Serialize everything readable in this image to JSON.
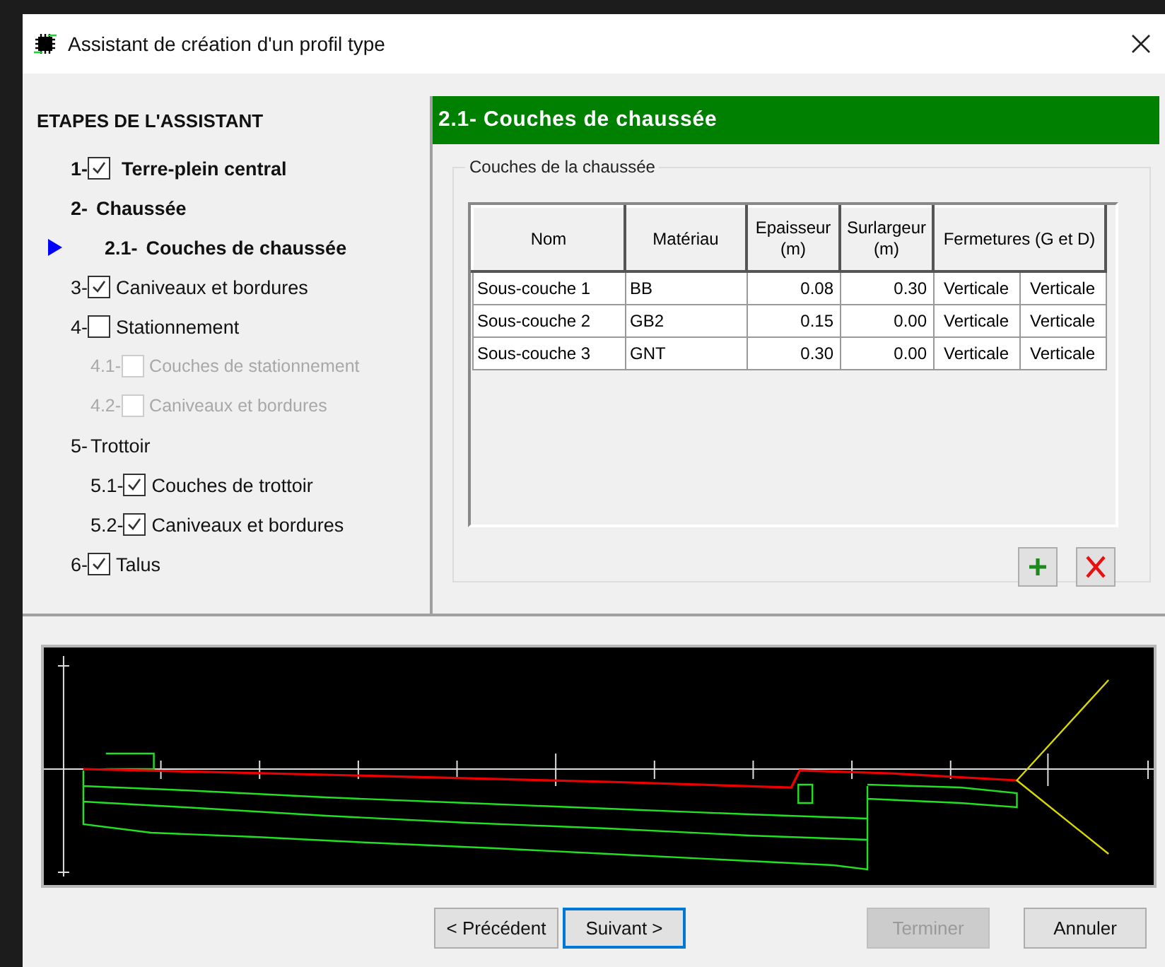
{
  "window": {
    "title": "Assistant de création d'un profil type"
  },
  "steps": {
    "title": "ETAPES DE L'ASSISTANT",
    "items": [
      {
        "kind": "checkbox",
        "number": "1-",
        "label": "Terre-plein central",
        "checked": true,
        "bold": true,
        "disabled": false,
        "current": false
      },
      {
        "kind": "plain",
        "number": "2-",
        "label": "Chaussée",
        "bold": true,
        "disabled": false,
        "current": false,
        "children": [
          {
            "kind": "plain",
            "number": "2.1-",
            "label": "Couches de chaussée",
            "bold": true,
            "disabled": false,
            "current": true
          }
        ]
      },
      {
        "kind": "checkbox",
        "number": "3-",
        "label": "Caniveaux et bordures",
        "checked": true,
        "bold": false,
        "disabled": false,
        "current": false
      },
      {
        "kind": "checkbox",
        "number": "4-",
        "label": "Stationnement",
        "checked": false,
        "bold": false,
        "disabled": false,
        "current": false,
        "children": [
          {
            "kind": "checkbox",
            "number": "4.1-",
            "label": "Couches de stationnement",
            "checked": false,
            "bold": false,
            "disabled": true,
            "current": false
          },
          {
            "kind": "checkbox",
            "number": "4.2-",
            "label": "Caniveaux et bordures",
            "checked": false,
            "bold": false,
            "disabled": true,
            "current": false
          }
        ]
      },
      {
        "kind": "plain",
        "number": "5-",
        "label": "Trottoir",
        "bold": false,
        "disabled": false,
        "current": false,
        "children": [
          {
            "kind": "checkbox",
            "number": "5.1-",
            "label": "Couches de trottoir",
            "checked": true,
            "bold": false,
            "disabled": false,
            "current": false
          },
          {
            "kind": "checkbox",
            "number": "5.2-",
            "label": "Caniveaux et bordures",
            "checked": true,
            "bold": false,
            "disabled": false,
            "current": false
          }
        ]
      },
      {
        "kind": "checkbox",
        "number": "6-",
        "label": "Talus",
        "checked": true,
        "bold": false,
        "disabled": false,
        "current": false
      }
    ]
  },
  "panel": {
    "title": "2.1- Couches de chaussée",
    "group_title": "Couches de la chaussée",
    "table": {
      "columns": [
        {
          "label": "Nom"
        },
        {
          "label": "Matériau"
        },
        {
          "label": "Epaisseur (m)"
        },
        {
          "label": "Surlargeur (m)"
        },
        {
          "label": "Fermetures (G et D)",
          "colspan": 2
        }
      ],
      "rows": [
        [
          "Sous-couche 1",
          "BB",
          "0.08",
          "0.30",
          "Verticale",
          "Verticale"
        ],
        [
          "Sous-couche 2",
          "GB2",
          "0.15",
          "0.00",
          "Verticale",
          "Verticale"
        ],
        [
          "Sous-couche 3",
          "GNT",
          "0.30",
          "0.00",
          "Verticale",
          "Verticale"
        ]
      ]
    }
  },
  "buttons": [
    {
      "label": "< Précédent",
      "disabled": false,
      "focused": false
    },
    {
      "label": "Suivant >",
      "disabled": false,
      "focused": true
    },
    {
      "label": "Terminer",
      "disabled": true,
      "focused": false
    },
    {
      "label": "Annuler",
      "disabled": false,
      "focused": false
    }
  ]
}
